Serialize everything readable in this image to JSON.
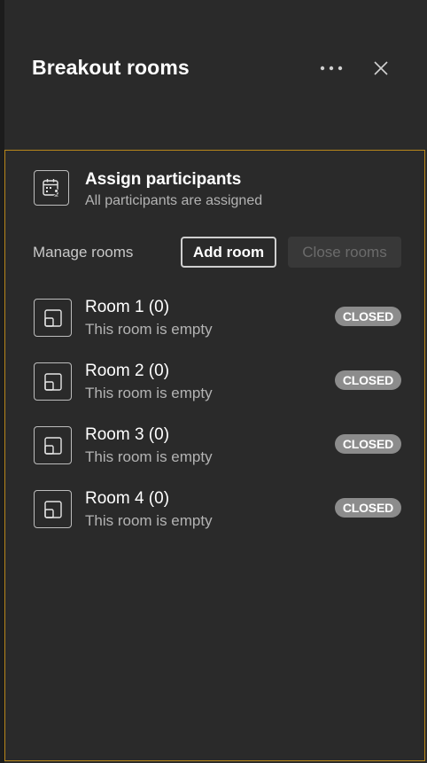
{
  "header": {
    "title": "Breakout rooms",
    "more_icon": "more-horizontal-icon",
    "close_icon": "close-icon"
  },
  "assign": {
    "icon": "calendar-people-icon",
    "title": "Assign participants",
    "subtitle": "All participants are assigned"
  },
  "manage": {
    "label": "Manage rooms",
    "add_room": "Add room",
    "close_rooms": "Close rooms"
  },
  "rooms": [
    {
      "name": "Room 1 (0)",
      "status": "This room is empty",
      "badge": "CLOSED",
      "icon": "room-icon"
    },
    {
      "name": "Room 2 (0)",
      "status": "This room is empty",
      "badge": "CLOSED",
      "icon": "room-icon"
    },
    {
      "name": "Room 3 (0)",
      "status": "This room is empty",
      "badge": "CLOSED",
      "icon": "room-icon"
    },
    {
      "name": "Room 4 (0)",
      "status": "This room is empty",
      "badge": "CLOSED",
      "icon": "room-icon"
    }
  ],
  "colors": {
    "background": "#2a2a2a",
    "panel_border": "#b8861b",
    "badge": "#8c8c8c",
    "secondary_text": "#b3b3b3"
  }
}
